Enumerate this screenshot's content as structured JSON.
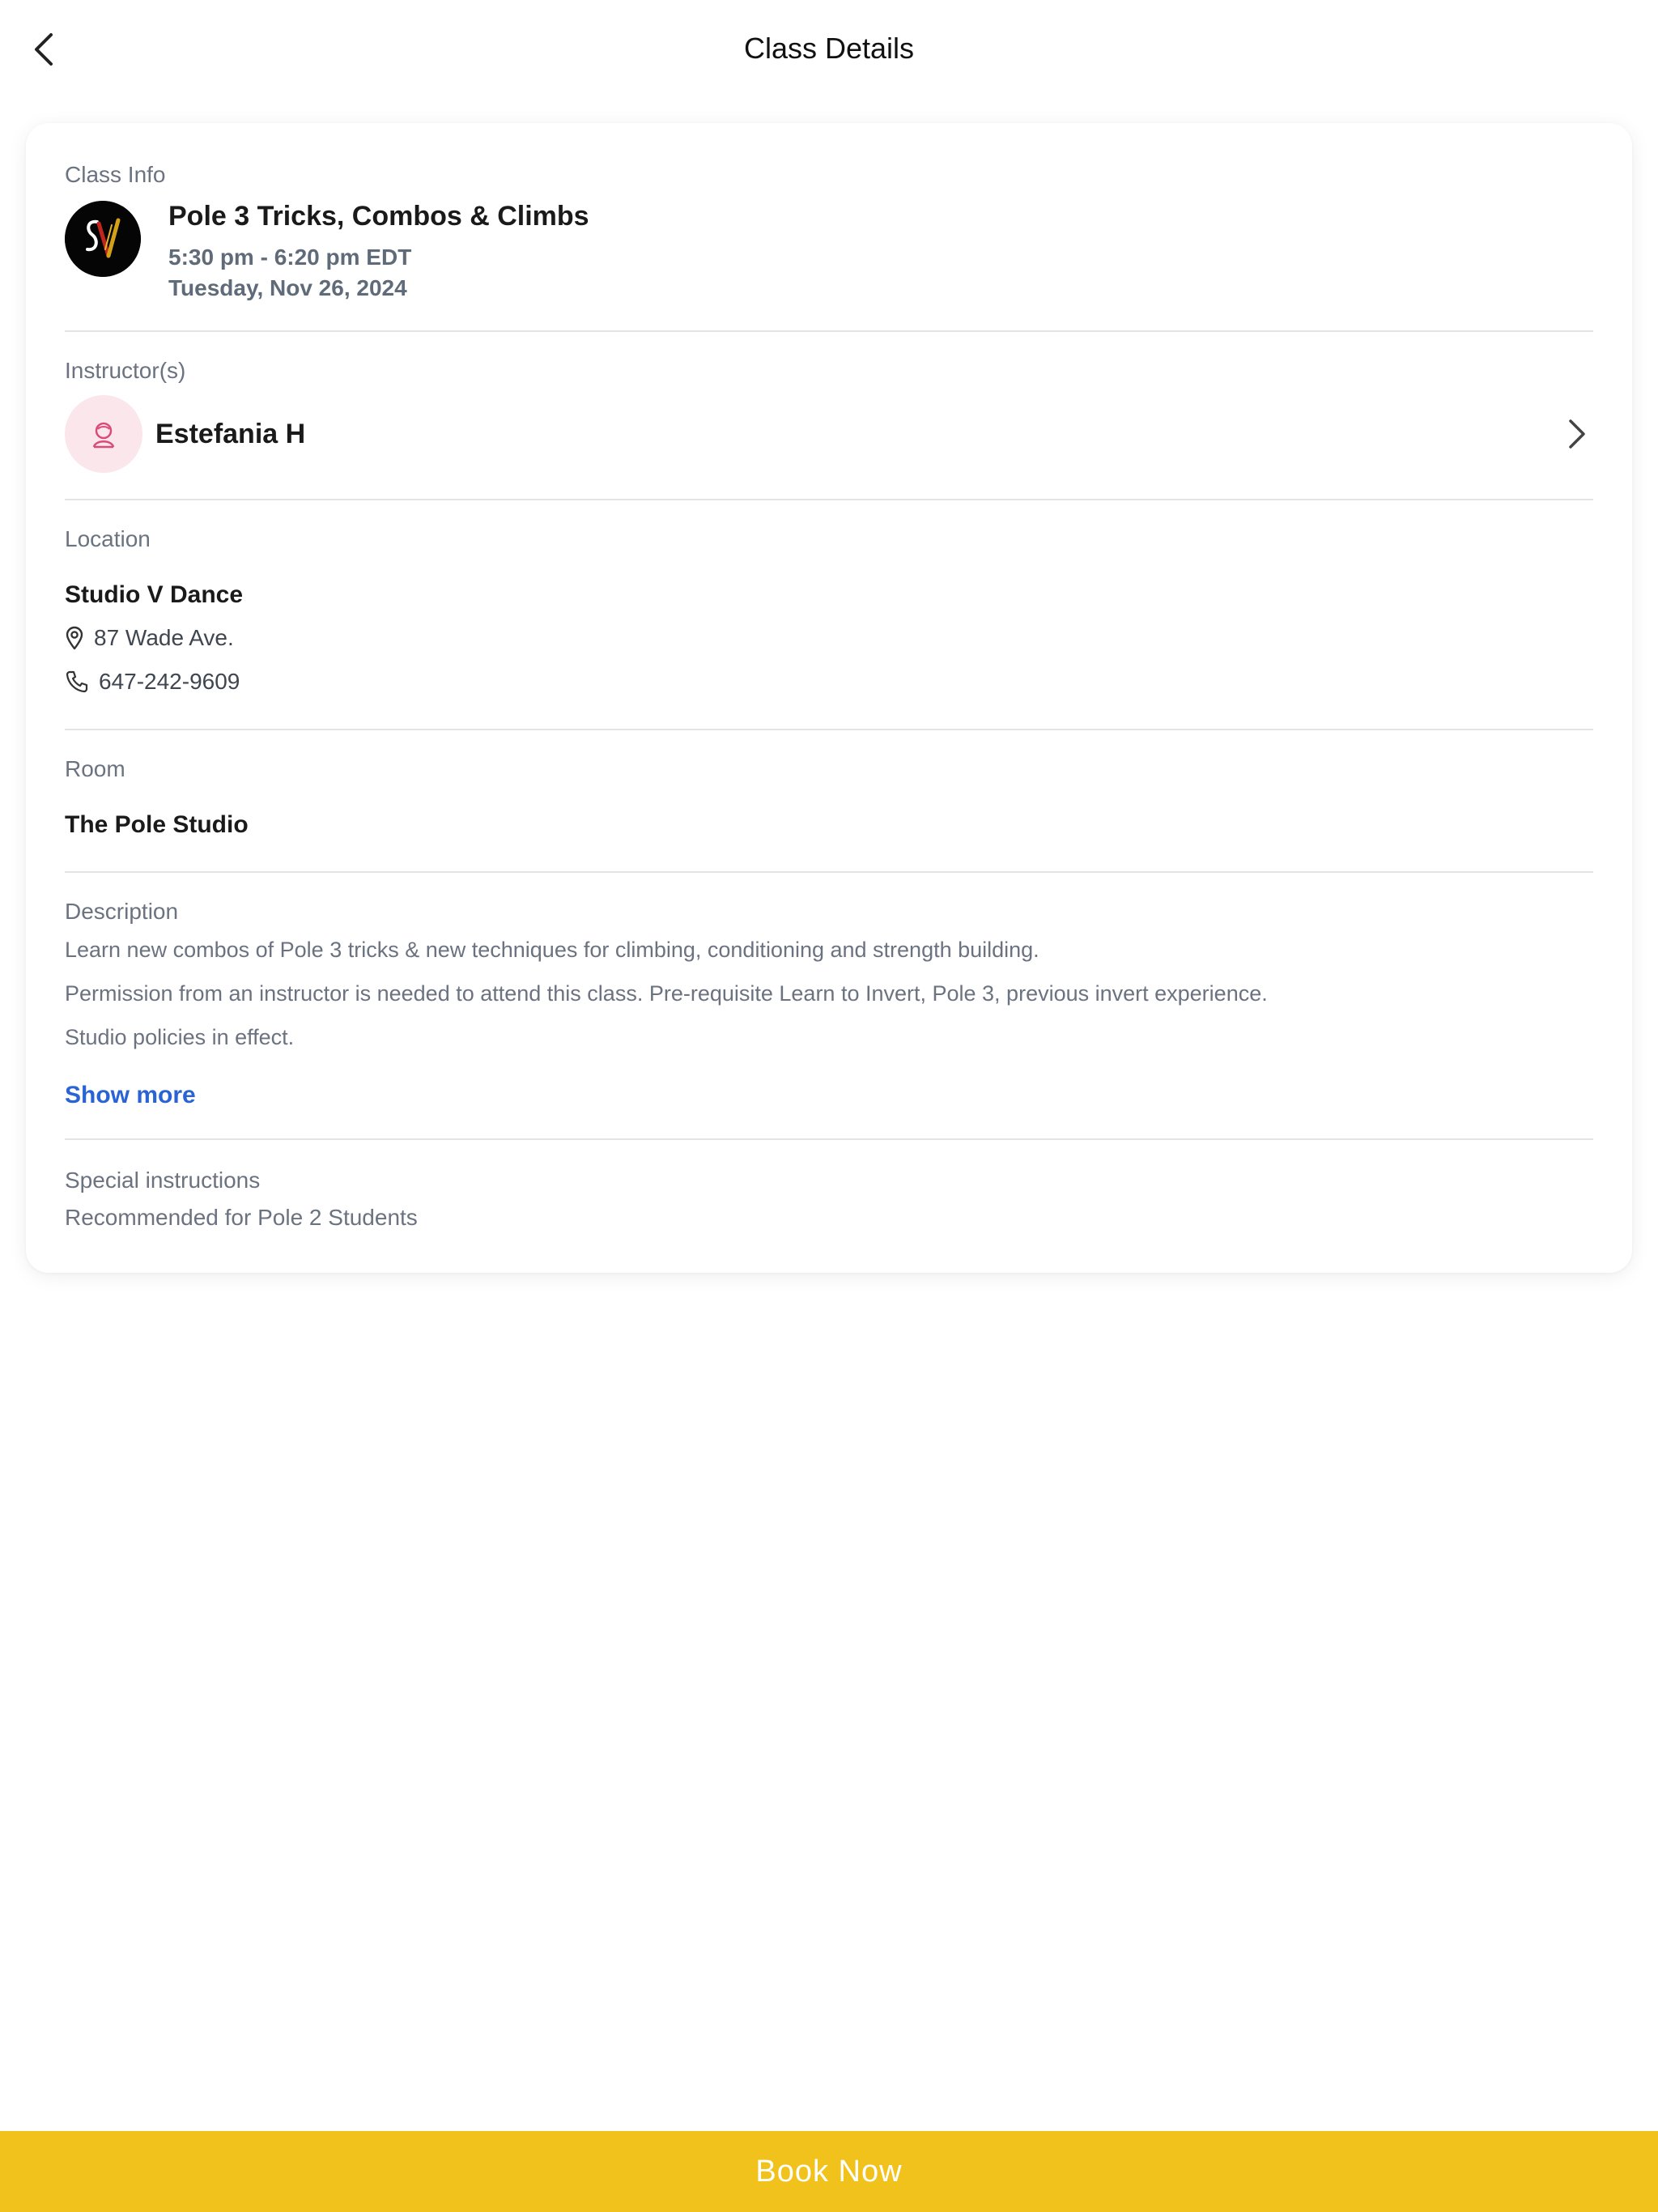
{
  "header": {
    "title": "Class Details",
    "back_icon": "chevron-left-icon"
  },
  "class_info": {
    "section_label": "Class Info",
    "logo_text": "SV",
    "title": "Pole 3 Tricks, Combos & Climbs",
    "time": "5:30 pm - 6:20 pm EDT",
    "date": "Tuesday, Nov 26, 2024"
  },
  "instructor": {
    "section_label": "Instructor(s)",
    "name": "Estefania H",
    "avatar_icon": "person-icon"
  },
  "location": {
    "section_label": "Location",
    "name": "Studio V Dance",
    "address": "87 Wade Ave.",
    "phone": "647-242-9609"
  },
  "room": {
    "section_label": "Room",
    "name": "The Pole Studio"
  },
  "description": {
    "section_label": "Description",
    "paragraphs": [
      "Learn new combos of Pole 3 tricks & new techniques for climbing, conditioning and strength building.",
      "Permission from an instructor is needed to attend this class. Pre-requisite Learn to Invert, Pole 3,  previous invert experience.",
      "Studio policies in effect."
    ],
    "show_more_label": "Show more"
  },
  "special": {
    "section_label": "Special instructions",
    "text": "Recommended for Pole 2 Students"
  },
  "footer": {
    "book_label": "Book Now"
  },
  "colors": {
    "accent": "#f1c21b",
    "link": "#2a63d4",
    "avatar_bg": "#fbe6ec",
    "avatar_icon": "#d94b7a"
  }
}
